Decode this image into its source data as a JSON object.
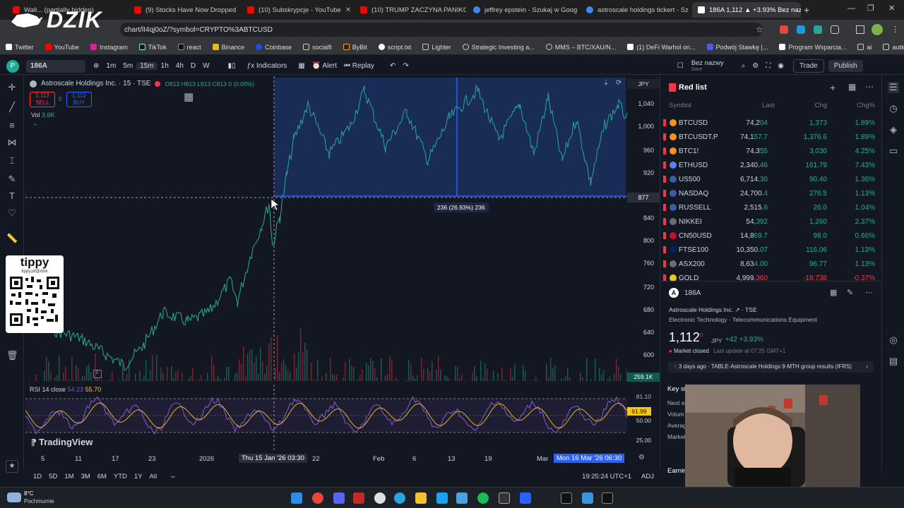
{
  "browser": {
    "tabs": [
      {
        "label": "Wall... (partially hidden)",
        "active": false
      },
      {
        "label": "(9) Stocks Have Now Dropped",
        "active": false
      },
      {
        "label": "(10) Subskrypcje - YouTube",
        "active": false
      },
      {
        "label": "(10) TRUMP ZACZYNA PANIKO",
        "active": false
      },
      {
        "label": "jeffrey epstein - Szukaj w Goog",
        "active": false
      },
      {
        "label": "astroscale holdings tickert - Sz",
        "active": false
      },
      {
        "label": "186A 1,112 ▲ +3.93% Bez naz",
        "active": true
      }
    ],
    "url": "chart/lI4qj0oZ/?symbol=CRYPTO%3ABTCUSD",
    "logo_text": "DZIK",
    "bookmarks": [
      "Twitter",
      "YouTube",
      "Instagram",
      "TikTok",
      "react",
      "Binance",
      "Coinbase",
      "socialfi",
      "ByBit",
      "script.txt",
      "Lighter",
      "Strategic Investing a...",
      "MMS – BTC/XAU/N...",
      "(1) DeFi Warhol on...",
      "Podwój Stawkę |...",
      "Program Wsparcia...",
      "ai",
      "autka"
    ]
  },
  "toolbar": {
    "symbol": "186A",
    "intervals": [
      "1m",
      "5m",
      "15m",
      "1h",
      "4h",
      "D",
      "W"
    ],
    "active_interval": "15m",
    "indicators_label": "Indicators",
    "alert_label": "Alert",
    "replay_label": "Replay",
    "layout_name": "Bez nazwy",
    "layout_sub": "Save",
    "trade_label": "Trade",
    "publish_label": "Publish"
  },
  "legend": {
    "title": "Astroscale Holdings Inc. · 15 · TSE",
    "ohlc": "O813 H813 L813 C813 0 (0.00%)",
    "sell_price": "1,112",
    "sell_label": "SELL",
    "buy_price": "1,112",
    "buy_label": "BUY",
    "spread": "0",
    "vol_label": "Vol",
    "vol_value": "3.6K",
    "currency": "JPY"
  },
  "chart": {
    "measure_label": "236 (26.93%) 236",
    "crosshair_price": "877",
    "volume_label": "259.1K",
    "price_ticks": [
      "1,040",
      "1,000",
      "960",
      "920",
      "840",
      "800",
      "760",
      "720",
      "680",
      "640",
      "600"
    ],
    "time_ticks": [
      "5",
      "11",
      "17",
      "23",
      "2026",
      "22",
      "Feb",
      "6",
      "13",
      "19",
      "Mar"
    ],
    "crosshair_time_left": "Thu 15 Jan '26",
    "crosshair_time_left2": "03:30",
    "crosshair_time_right": "Mon 16 Mar '26",
    "crosshair_time_right2": "06:30",
    "watermark": "TradingView"
  },
  "rsi": {
    "label": "RSI 14 close",
    "v1": "54.23",
    "v2": "55.70",
    "ticks": [
      "81.10",
      "61.99",
      "50.00",
      "25.00"
    ]
  },
  "ranges": [
    "1D",
    "5D",
    "1M",
    "3M",
    "6M",
    "YTD",
    "1Y",
    "All"
  ],
  "clock": "19:25:24 UTC+1",
  "adj": "ADJ",
  "watchlist": {
    "title": "Red list",
    "columns": [
      "Symbol",
      "Last",
      "Chg",
      "Chg%"
    ],
    "rows": [
      {
        "symbol": "BTCUSD",
        "last": "74,2",
        "last_tail": "04",
        "chg": "1,373",
        "chgp": "1.89%",
        "dir": "pos",
        "icon": "#f7931a"
      },
      {
        "symbol": "BTCUSDT.P",
        "last": "74,1",
        "last_tail": "57.7",
        "chg": "1,376.6",
        "chgp": "1.89%",
        "dir": "pos",
        "icon": "#f7931a"
      },
      {
        "symbol": "BTC1!",
        "last": "74,3",
        "last_tail": "55",
        "chg": "3,030",
        "chgp": "4.25%",
        "dir": "pos",
        "icon": "#f7931a"
      },
      {
        "symbol": "ETHUSD",
        "last": "2,340.",
        "last_tail": "46",
        "chg": "161.79",
        "chgp": "7.43%",
        "dir": "pos",
        "icon": "#627eea"
      },
      {
        "symbol": "US500",
        "last": "6,714.",
        "last_tail": "30",
        "chg": "90.40",
        "chgp": "1.36%",
        "dir": "pos",
        "icon": "#3c5aa6"
      },
      {
        "symbol": "NASDAQ",
        "last": "24,700.",
        "last_tail": "4",
        "chg": "276.5",
        "chgp": "1.13%",
        "dir": "pos",
        "icon": "#3c5aa6"
      },
      {
        "symbol": "RUSSELL",
        "last": "2,515.",
        "last_tail": "6",
        "chg": "26.0",
        "chgp": "1.04%",
        "dir": "pos",
        "icon": "#3c5aa6"
      },
      {
        "symbol": "NIKKEI",
        "last": "54,",
        "last_tail": "392",
        "chg": "1,260",
        "chgp": "2.37%",
        "dir": "pos",
        "icon": "#6a6d78"
      },
      {
        "symbol": "CN50USD",
        "last": "14,8",
        "last_tail": "69.7",
        "chg": "98.0",
        "chgp": "0.66%",
        "dir": "pos",
        "icon": "#c8102e"
      },
      {
        "symbol": "FTSE100",
        "last": "10,350.",
        "last_tail": "07",
        "chg": "116.06",
        "chgp": "1.13%",
        "dir": "pos",
        "icon": "#012169"
      },
      {
        "symbol": "ASX200",
        "last": "8,63",
        "last_tail": "4.00",
        "chg": "96.77",
        "chgp": "1.13%",
        "dir": "pos",
        "icon": "#6a6d78"
      },
      {
        "symbol": "GOLD",
        "last": "4,999.",
        "last_tail": "360",
        "chg": "-18.738",
        "chgp": "-0.37%",
        "dir": "neg",
        "icon": "#f5c518"
      }
    ]
  },
  "details": {
    "symbol": "186A",
    "name": "Astroscale Holdings Inc.",
    "exchange": "TSE",
    "sector": "Electronic Technology",
    "industry": "Telecommunications Equipment",
    "price": "1,112",
    "price_suffix": "D",
    "currency": "JPY",
    "change": "+42",
    "change_pct": "+3.93%",
    "market_status": "Market closed",
    "last_update": "Last update at 07:25 GMT+1",
    "news": "3 days ago · TABLE-Astroscale Holdings 9-MTH group results (IFRS)",
    "key_stats": "Key st",
    "stat_rows": [
      "Next e",
      "Volum",
      "Averag",
      "Market"
    ],
    "earnings": "Earnin"
  },
  "tippy": {
    "label": "tippy",
    "url": "tippy.pl/@dzik"
  },
  "taskbar": {
    "temp": "8°C",
    "weather": "Pochmurnie"
  },
  "colors": {
    "bg": "#131722",
    "accent": "#2962ff",
    "up": "#22ab94",
    "down": "#f23645",
    "rsi": "#7e57c2",
    "rsi_band": "#f5c518"
  }
}
